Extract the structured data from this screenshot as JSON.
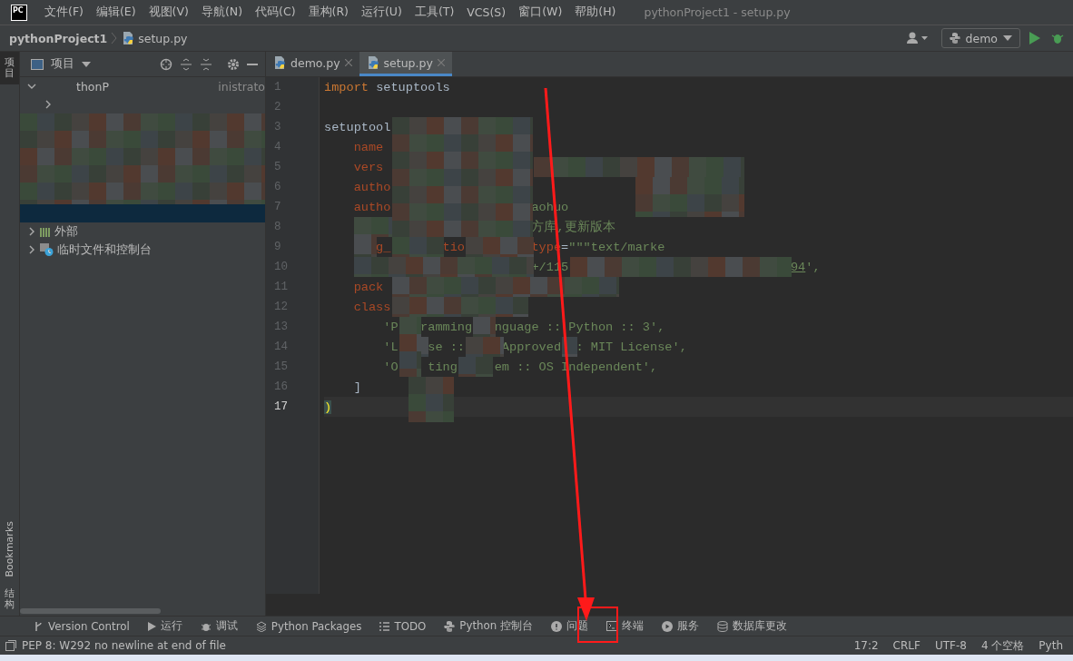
{
  "logo_text": "PC",
  "menu": [
    "文件(F)",
    "编辑(E)",
    "视图(V)",
    "导航(N)",
    "代码(C)",
    "重构(R)",
    "运行(U)",
    "工具(T)",
    "VCS(S)",
    "窗口(W)",
    "帮助(H)"
  ],
  "window_title": "pythonProject1 - setup.py",
  "breadcrumb": [
    "pythonProject1",
    "setup.py"
  ],
  "run_config": "demo",
  "side_tabs_top": [
    {
      "label": "项目",
      "selected": true
    }
  ],
  "side_tabs_bottom": [
    {
      "label": "Bookmarks",
      "selected": false
    },
    {
      "label": "结构",
      "selected": false
    }
  ],
  "project_panel": {
    "title": "项目",
    "tree": [
      {
        "label": "thonP",
        "suffix": "inistrato",
        "expanded": true,
        "selected": false,
        "children": [
          {
            "expanded": false,
            "selected": false
          },
          {
            "selected": true
          }
        ]
      },
      {
        "label": "外部",
        "kind": "library",
        "expanded": false,
        "selected": false
      },
      {
        "label": "临时文件和控制台",
        "kind": "scratch",
        "expanded": false,
        "selected": false
      }
    ]
  },
  "editor_tabs": [
    {
      "label": "demo.py",
      "selected": false
    },
    {
      "label": "setup.py",
      "selected": true
    }
  ],
  "code_lines": [
    {
      "number": "1",
      "current": false,
      "tokens": [
        {
          "kind": "kw",
          "text": "import"
        },
        {
          "kind": "plain",
          "text": " setuptools"
        }
      ]
    },
    {
      "number": "2",
      "current": false
    },
    {
      "number": "3",
      "current": false,
      "tokens": [
        {
          "kind": "plain",
          "text": "setuptool"
        }
      ]
    },
    {
      "number": "4",
      "current": false,
      "tokens": [
        {
          "kind": "param",
          "text": "    name"
        }
      ]
    },
    {
      "number": "5",
      "current": false,
      "tokens": [
        {
          "kind": "param",
          "text": "    vers"
        }
      ]
    },
    {
      "number": "6",
      "current": false,
      "tokens": [
        {
          "kind": "param",
          "text": "    autho"
        }
      ]
    },
    {
      "number": "7",
      "current": false,
      "tokens": [
        {
          "kind": "param",
          "text": "    autho"
        },
        {
          "kind": "str",
          "text": "                   aohuo"
        }
      ]
    },
    {
      "number": "8",
      "current": false,
      "tokens": [
        {
          "kind": "str",
          "text": "                            方库,更新版本"
        }
      ]
    },
    {
      "number": "9",
      "current": false,
      "tokens": [
        {
          "kind": "param",
          "text": "       g_"
        },
        {
          "kind": "param",
          "text": "       tio"
        },
        {
          "kind": "param",
          "text": "         type"
        },
        {
          "kind": "plain",
          "text": "="
        },
        {
          "kind": "str",
          "text": "\"\"\"text/marke"
        }
      ]
    },
    {
      "number": "10",
      "current": false,
      "tokens": [
        {
          "kind": "str",
          "text": "                            +/115"
        },
        {
          "kind": "link",
          "text": "                              94"
        },
        {
          "kind": "str",
          "text": "',"
        }
      ]
    },
    {
      "number": "11",
      "current": false,
      "tokens": [
        {
          "kind": "param",
          "text": "    pack"
        }
      ]
    },
    {
      "number": "12",
      "current": false,
      "tokens": [
        {
          "kind": "param",
          "text": "    class"
        }
      ]
    },
    {
      "number": "13",
      "current": false,
      "tokens": [
        {
          "kind": "str",
          "text": "        'P"
        },
        {
          "kind": "str",
          "text": "   ramming"
        },
        {
          "kind": "str",
          "text": "   nguage :: Python :: 3',"
        }
      ]
    },
    {
      "number": "14",
      "current": false,
      "tokens": [
        {
          "kind": "str",
          "text": "        'L"
        },
        {
          "kind": "str",
          "text": "    se ::"
        },
        {
          "kind": "str",
          "text": "     Approved"
        },
        {
          "kind": "str",
          "text": "  : MIT License',"
        }
      ]
    },
    {
      "number": "15",
      "current": false,
      "tokens": [
        {
          "kind": "str",
          "text": "        'O"
        },
        {
          "kind": "str",
          "text": "    ting"
        },
        {
          "kind": "str",
          "text": "     em :: OS Independent',"
        }
      ]
    },
    {
      "number": "16",
      "current": false,
      "tokens": [
        {
          "kind": "plain",
          "text": "    ]"
        }
      ]
    },
    {
      "number": "17",
      "current": true,
      "tokens": [
        {
          "kind": "brace",
          "text": ")"
        }
      ]
    }
  ],
  "tool_tabs": [
    {
      "kind": "vcs",
      "label": "Version Control"
    },
    {
      "kind": "run",
      "label": "运行"
    },
    {
      "kind": "debug",
      "label": "调试"
    },
    {
      "kind": "packages",
      "label": "Python Packages"
    },
    {
      "kind": "todo",
      "label": "TODO"
    },
    {
      "kind": "python",
      "label": "Python 控制台"
    },
    {
      "kind": "problems",
      "label": "问题"
    },
    {
      "kind": "terminal",
      "label": "终端"
    },
    {
      "kind": "services",
      "label": "服务"
    },
    {
      "kind": "database",
      "label": "数据库更改"
    }
  ],
  "status": {
    "message": "PEP 8: W292 no newline at end of file",
    "items": [
      "17:2",
      "CRLF",
      "UTF-8",
      "4 个空格",
      "Pyth"
    ]
  }
}
